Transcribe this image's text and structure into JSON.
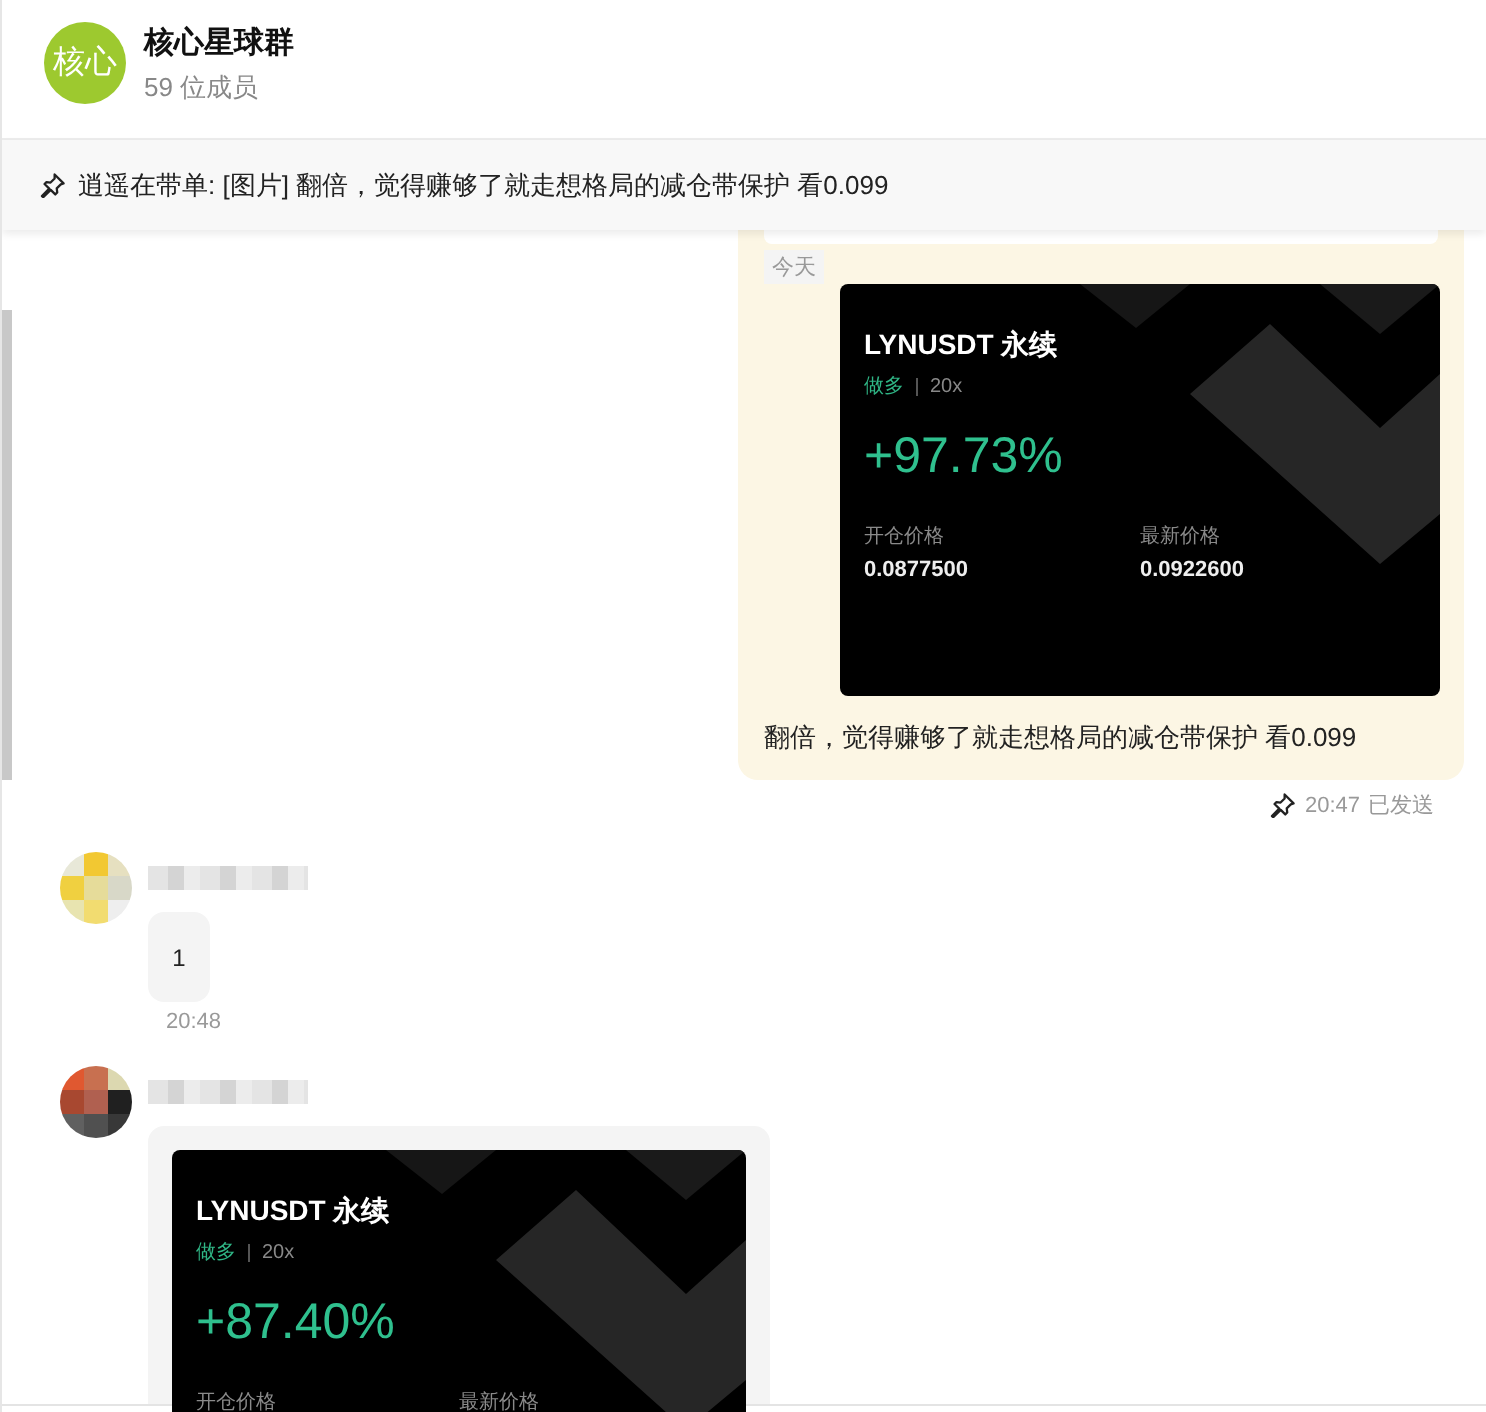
{
  "header": {
    "avatar_text": "核心",
    "title": "核心星球群",
    "subtitle": "59 位成员"
  },
  "pinned_bar": {
    "text": "逍遥在带单: [图片] 翻倍，觉得赚够了就走想格局的减仓带保护 看0.099"
  },
  "messages": [
    {
      "kind": "outgoing",
      "date_label": "今天",
      "card": {
        "symbol": "LYNUSDT 永续",
        "side": "做多",
        "leverage": "20x",
        "pnl": "+97.73%",
        "fields": [
          {
            "label": "开仓价格",
            "value": "0.0877500"
          },
          {
            "label": "最新价格",
            "value": "0.0922600"
          }
        ]
      },
      "text": "翻倍，觉得赚够了就走想格局的减仓带保护  看0.099",
      "pinned": true,
      "time": "20:47",
      "status": "已发送"
    },
    {
      "kind": "incoming",
      "text": "1",
      "time": "20:48"
    },
    {
      "kind": "incoming",
      "card": {
        "symbol": "LYNUSDT 永续",
        "side": "做多",
        "leverage": "20x",
        "pnl": "+87.40%",
        "fields": [
          {
            "label": "开仓价格"
          },
          {
            "label": "最新价格"
          }
        ]
      }
    }
  ]
}
